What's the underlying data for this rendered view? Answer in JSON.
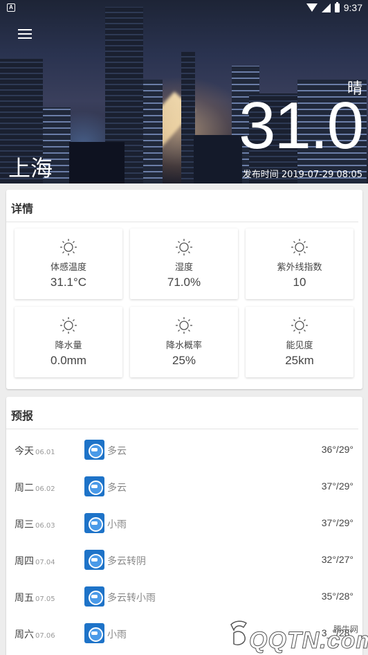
{
  "status_bar": {
    "time": "9:37",
    "left_icon": "A"
  },
  "header": {
    "menu_icon": "hamburger-menu-icon",
    "weather": "晴",
    "temperature": "31.0",
    "city": "上海",
    "publish_time": "发布时间 2019-07-29 08:05"
  },
  "details": {
    "title": "详情",
    "items": [
      {
        "icon": "sun-icon",
        "label": "体感温度",
        "value": "31.1°C"
      },
      {
        "icon": "sun-icon",
        "label": "湿度",
        "value": "71.0%"
      },
      {
        "icon": "sun-icon",
        "label": "紫外线指数",
        "value": "10"
      },
      {
        "icon": "sun-icon",
        "label": "降水量",
        "value": "0.0mm"
      },
      {
        "icon": "sun-icon",
        "label": "降水概率",
        "value": "25%"
      },
      {
        "icon": "sun-icon",
        "label": "能见度",
        "value": "25km"
      }
    ]
  },
  "forecast": {
    "title": "预报",
    "rows": [
      {
        "day": "今天",
        "date": "06.01",
        "desc": "多云",
        "temps": "36°/29°"
      },
      {
        "day": "周二",
        "date": "06.02",
        "desc": "多云",
        "temps": "37°/29°"
      },
      {
        "day": "周三",
        "date": "06.03",
        "desc": "小雨",
        "temps": "37°/29°"
      },
      {
        "day": "周四",
        "date": "07.04",
        "desc": "多云转阴",
        "temps": "32°/27°"
      },
      {
        "day": "周五",
        "date": "07.05",
        "desc": "多云转小雨",
        "temps": "35°/28°"
      },
      {
        "day": "周六",
        "date": "07.06",
        "desc": "小雨",
        "temps": "3_°/28°"
      }
    ]
  },
  "watermark": {
    "small": "腾牛网",
    "big": "QQTN.com"
  }
}
